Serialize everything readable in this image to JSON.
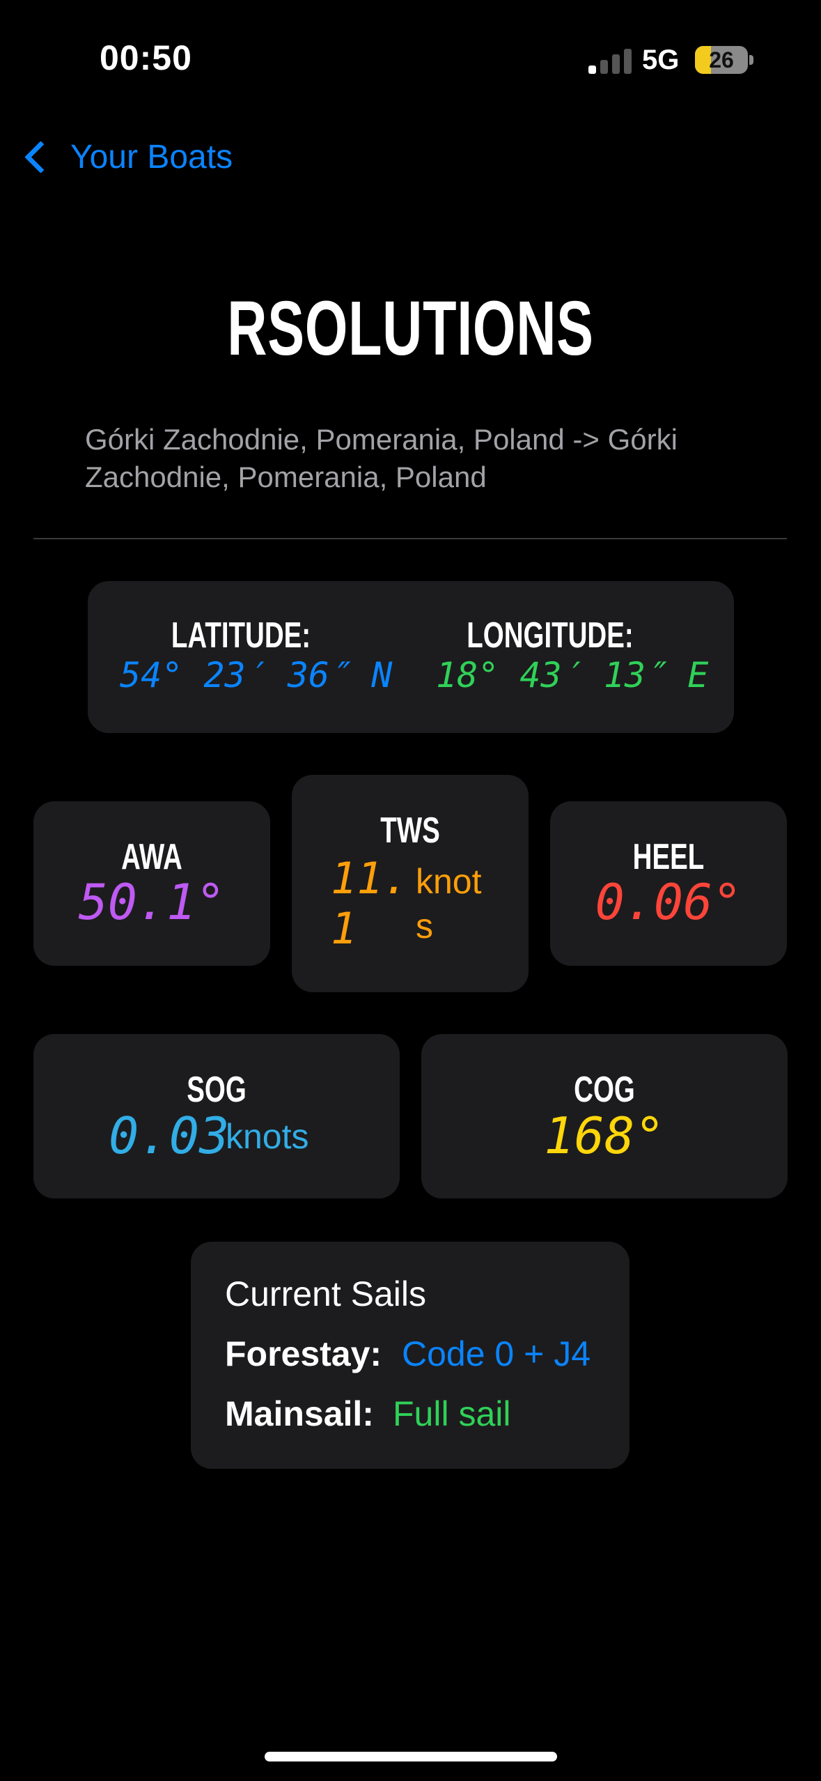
{
  "status_bar": {
    "time": "00:50",
    "network": "5G",
    "battery": "26"
  },
  "nav": {
    "back_label": "Your Boats"
  },
  "boat": {
    "name": "RSOLUTIONS",
    "route": "Górki Zachodnie, Pomerania, Poland -> Górki Zachodnie, Pomerania, Poland"
  },
  "position": {
    "latitude_label": "LATITUDE:",
    "latitude_value": "54° 23′ 36″ N",
    "longitude_label": "LONGITUDE:",
    "longitude_value": "18° 43′ 13″ E"
  },
  "awa": {
    "label": "AWA",
    "value": "50.1°"
  },
  "tws": {
    "label": "TWS",
    "value_line1": "11.",
    "value_line2": "1",
    "unit_line1": "knot",
    "unit_line2": "s"
  },
  "heel": {
    "label": "HEEL",
    "value": "0.06°"
  },
  "sog": {
    "label": "SOG",
    "value": "0.03",
    "unit": "knots"
  },
  "cog": {
    "label": "COG",
    "value": "168°"
  },
  "sails": {
    "title": "Current Sails",
    "forestay_label": "Forestay:",
    "forestay_value": "Code 0 + J4",
    "mainsail_label": "Mainsail:",
    "mainsail_value": "Full sail"
  },
  "colors": {
    "accent": "#0a84ff",
    "latitude": "#0a84ff",
    "longitude": "#30d158",
    "awa": "#bf5af2",
    "tws": "#ff9f0a",
    "heel": "#ff453a",
    "sog": "#32ade6",
    "cog": "#ffd60a",
    "card_bg": "#1c1c1e"
  }
}
